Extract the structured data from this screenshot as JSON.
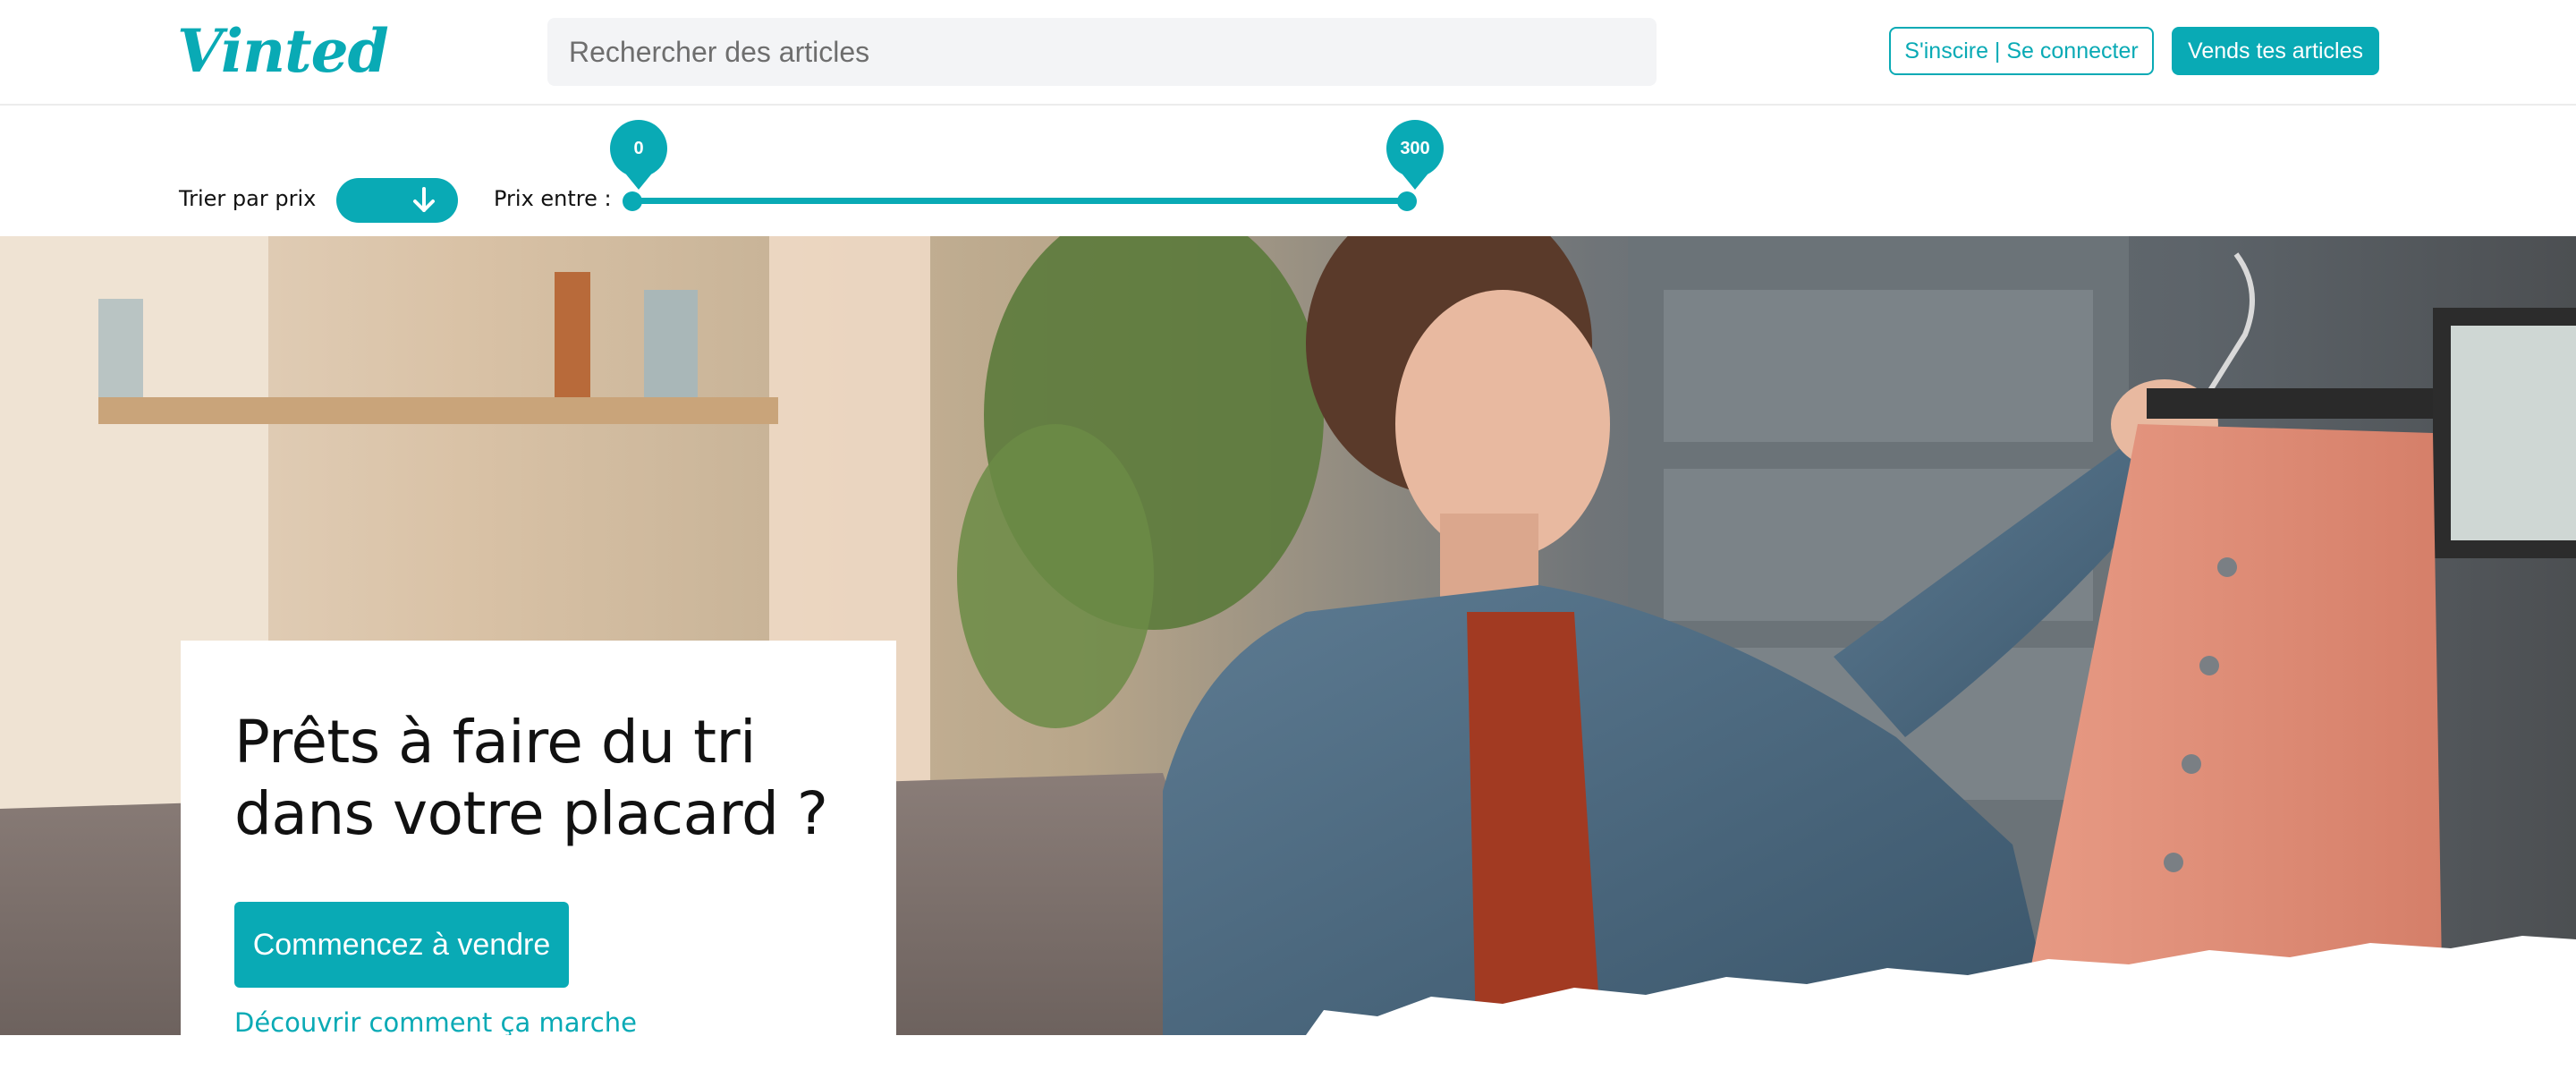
{
  "header": {
    "logo_text": "Vinted",
    "search_placeholder": "Rechercher des articles",
    "login_label": "S'inscire | Se connecter",
    "sell_label": "Vends tes articles"
  },
  "filters": {
    "sort_label": "Trier par prix",
    "sort_direction_icon": "arrow-down-icon",
    "price_label": "Prix entre :",
    "price_min": "0",
    "price_max": "300"
  },
  "hero": {
    "title_line1": "Prêts à faire du tri",
    "title_line2": "dans votre placard ?",
    "cta_label": "Commencez à vendre",
    "howto_link": "Découvrir comment ça marche"
  },
  "colors": {
    "accent": "#09aab5",
    "search_bg": "#f3f4f6"
  }
}
